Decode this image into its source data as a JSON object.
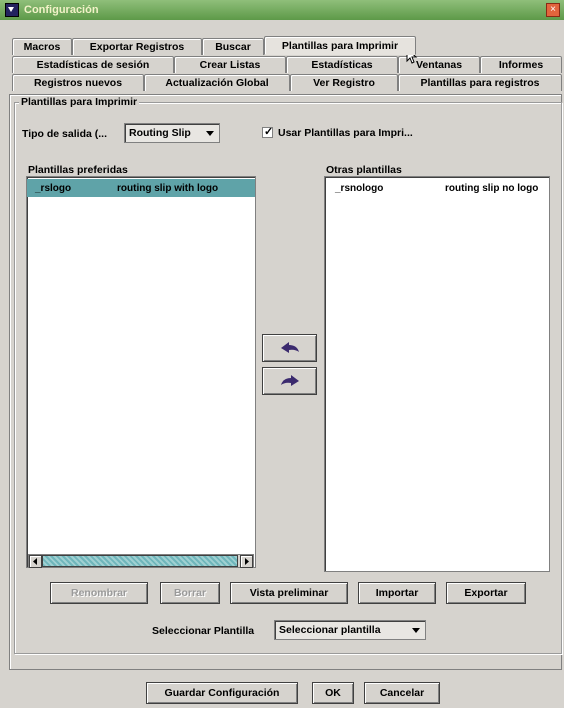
{
  "window": {
    "title": "Configuración",
    "close": "×"
  },
  "tabs": {
    "row1": [
      "Macros",
      "Exportar Registros",
      "Buscar",
      "Plantillas para Imprimir"
    ],
    "row2": [
      "Estadísticas de sesión",
      "Crear Listas",
      "Estadísticas",
      "Ventanas",
      "Informes"
    ],
    "row3": [
      "Registros nuevos",
      "Actualización Global",
      "Ver Registro",
      "Plantillas para registros"
    ]
  },
  "group": {
    "legend": "Plantillas para Imprimir"
  },
  "output": {
    "label": "Tipo de salida (...",
    "value": "Routing Slip",
    "use_templates_label": "Usar Plantillas para Impri...",
    "use_templates_checked": true
  },
  "preferred": {
    "label": "Plantillas preferidas",
    "rows": [
      {
        "name": "_rslogo",
        "desc": "routing slip with logo"
      }
    ]
  },
  "others": {
    "label": "Otras plantillas",
    "rows": [
      {
        "name": "_rsnologo",
        "desc": "routing slip no logo"
      }
    ]
  },
  "buttons": {
    "rename": "Renombrar",
    "delete": "Borrar",
    "preview": "Vista preliminar",
    "import": "Importar",
    "export": "Exportar",
    "save": "Guardar Configuración",
    "ok": "OK",
    "cancel": "Cancelar"
  },
  "select_template": {
    "label": "Seleccionar Plantilla",
    "value": "Seleccionar plantilla"
  },
  "colors": {
    "selection": "#5fa3a8",
    "title_bar": "#6fa85a",
    "arrow": "#3b2a6e"
  }
}
